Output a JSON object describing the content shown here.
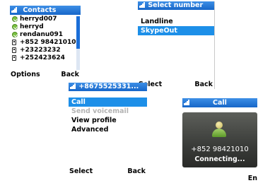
{
  "contacts_screen": {
    "title": "Contacts",
    "items": [
      {
        "label": "herryd007",
        "icon": "online-status-icon"
      },
      {
        "label": "herryd",
        "icon": "online-status-icon"
      },
      {
        "label": "rendanu091",
        "icon": "online-status-icon"
      },
      {
        "label": "+852 98421010",
        "icon": "phone-icon"
      },
      {
        "label": "+23223232",
        "icon": "phone-icon"
      },
      {
        "label": "+252423624",
        "icon": "phone-icon"
      }
    ],
    "softkey_left": "Options",
    "softkey_right": "Back"
  },
  "select_number_screen": {
    "title": "Select number",
    "items": [
      {
        "label": "Landline",
        "selected": false
      },
      {
        "label": "SkypeOut",
        "selected": true
      }
    ],
    "softkey_left": "Select",
    "softkey_right": "Back"
  },
  "call_options_screen": {
    "title": "+8675525331...",
    "items": [
      {
        "label": "Call",
        "selected": true,
        "disabled": false
      },
      {
        "label": "Send voicemail",
        "selected": false,
        "disabled": true
      },
      {
        "label": "View profile",
        "selected": false,
        "disabled": false
      },
      {
        "label": "Advanced",
        "selected": false,
        "disabled": false
      }
    ],
    "softkey_left": "Select",
    "softkey_right": "Back"
  },
  "calling_screen": {
    "title": "Call",
    "number": "+852 98421010",
    "status": "Connecting...",
    "softkey_right": "En"
  },
  "colors": {
    "titlebar": "#1766c8",
    "selection": "#1d8fe8",
    "disabled_text": "#b3b3b3",
    "call_panel": "#3a3c39",
    "online_icon": "#7bc142"
  }
}
